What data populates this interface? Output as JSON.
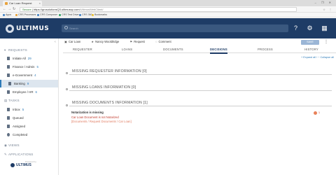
{
  "browser": {
    "tab_title": "Car Loan Request",
    "window_controls": "– ❐ ✕",
    "url_secure": "Secure",
    "url_host": "https://grosolutionsQ3.ultimussp.com",
    "url_path": "/UltimusWebClient/",
    "bookmarks": [
      "Apps",
      "CRS Processes",
      "CRS Composer",
      "CRS Test Drive",
      "CRS 360",
      "Bookmarks"
    ],
    "bookmark_colors": [
      "#4a86c5",
      "#e8a33c",
      "#4a86c5",
      "#3aa46b",
      "#4a86c5",
      "#e8c23c"
    ]
  },
  "app": {
    "logo": "ULTIMUS",
    "search_placeholder": "Search",
    "header_icons": [
      "help-icon",
      "settings-icon",
      "apps-icon"
    ],
    "header_glyphs": [
      "?",
      "⚙",
      "▦"
    ]
  },
  "sidebar": {
    "collapse_glyph": "‹",
    "requests_label": "REQUESTS",
    "requests": [
      {
        "label": "Initiate All",
        "count": "29"
      },
      {
        "label": "Finance / Admin",
        "count": "5"
      },
      {
        "label": "e-Government",
        "count": "4"
      },
      {
        "label": "Banking",
        "count": "9"
      },
      {
        "label": "Employee / HR",
        "count": "6"
      }
    ],
    "tasks_label": "TASKS",
    "tasks": [
      {
        "label": "Inbox",
        "count": "5"
      },
      {
        "label": "Queued",
        "count": ""
      },
      {
        "label": "Assigned",
        "count": ""
      },
      {
        "label": "Completed",
        "count": ""
      }
    ],
    "views_label": "VIEWS",
    "applications_label": "APPLICATIONS",
    "footer_powered": "Powered by",
    "footer_logo": "ULTIMUS"
  },
  "breadcrumb": {
    "items": [
      "Car Loan",
      "Nancy Wooldridge",
      "Request",
      "Comment"
    ]
  },
  "toolbar": {
    "save_label": "SAVE",
    "more_glyph": "⋮"
  },
  "tabs": [
    "REQUESTER",
    "LOANS",
    "DOCUMENTS",
    "DECISIONS",
    "PROCESS",
    "HISTORY"
  ],
  "active_tab": "DECISIONS",
  "expand_links": "+ Expand all / − Collapse all",
  "sections": [
    {
      "title": "MISSING REQUESTER INFORMATION [0]"
    },
    {
      "title": "MISSING LOANS INFORMATION [0]"
    },
    {
      "title": "MISSING DOCUMENTS INFORMATION [1]"
    }
  ],
  "document_issue": {
    "title": "Notarization is missing",
    "subtitle": "Car Loan Document is not Notarized",
    "path": "[Documents / Request Documents / Car Loan]",
    "count": "1",
    "colors": {
      "error": "#c0392b",
      "path": "#e07a5f"
    }
  }
}
